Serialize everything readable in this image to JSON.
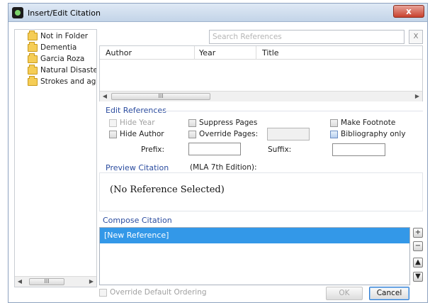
{
  "window": {
    "title": "Insert/Edit Citation",
    "close_label": "x"
  },
  "folders": [
    {
      "label": "Not in Folder"
    },
    {
      "label": "Dementia"
    },
    {
      "label": "Garcia Roza"
    },
    {
      "label": "Natural Disasters"
    },
    {
      "label": "Strokes and age"
    }
  ],
  "folder_scroll": {
    "thumb": "III"
  },
  "search": {
    "placeholder": "Search References",
    "clear_label": "X"
  },
  "results": {
    "columns": [
      "Author",
      "Year",
      "Title"
    ],
    "scroll_thumb": "III"
  },
  "edit_references": {
    "title": "Edit References",
    "hide_year": "Hide Year",
    "hide_author": "Hide Author",
    "suppress_pages": "Suppress Pages",
    "override_pages": "Override Pages:",
    "make_footnote": "Make Footnote",
    "bibliography_only": "Bibliography only",
    "prefix_label": "Prefix:",
    "suffix_label": "Suffix:",
    "prefix_value": "",
    "suffix_value": ""
  },
  "preview": {
    "title": "Preview Citation",
    "style": "(MLA 7th Edition):",
    "text": "(No Reference Selected)"
  },
  "compose": {
    "title": "Compose Citation",
    "items": [
      "[New Reference]"
    ],
    "add_label": "+",
    "remove_label": "−",
    "up_label": "▲",
    "down_label": "▼"
  },
  "footer": {
    "override_ordering": "Override Default Ordering",
    "ok_label": "OK",
    "cancel_label": "Cancel"
  }
}
